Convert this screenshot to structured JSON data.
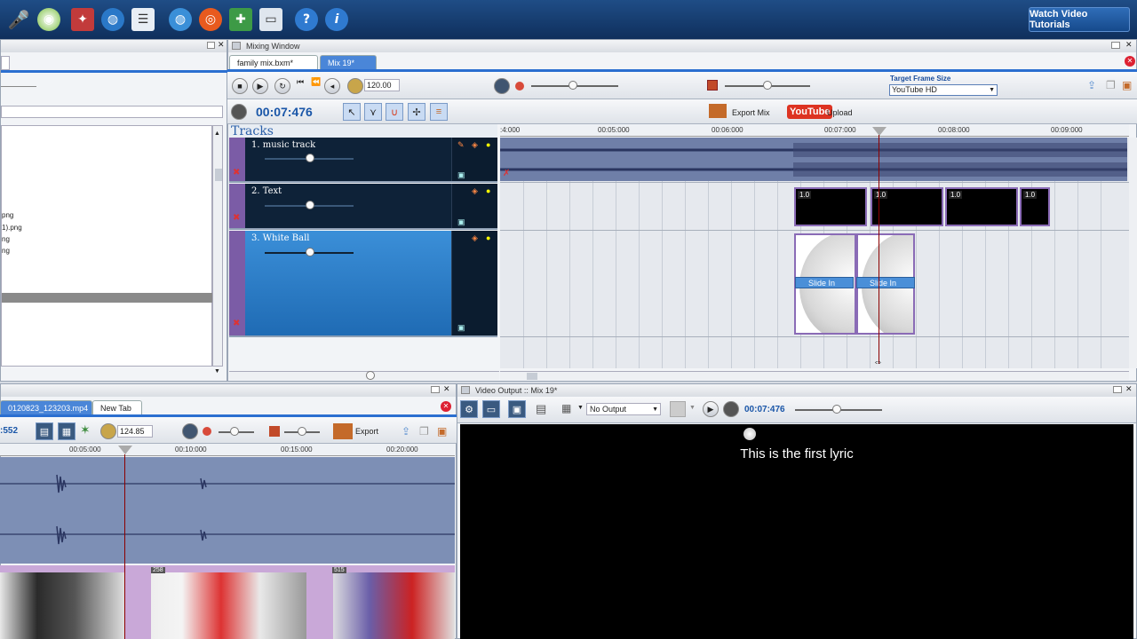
{
  "top_toolbar": {
    "watch_label": "Watch Video Tutorials"
  },
  "mixing_window": {
    "title": "Mixing Window",
    "tabs": [
      {
        "label": "family mix.bxm*"
      },
      {
        "label": "Mix 19*"
      }
    ],
    "bpm_value": "120.00",
    "time_display": "00:07:476",
    "export_label": "Export Mix",
    "upload_label": "Upload",
    "youtube_label": "YouTube",
    "target_frame_label": "Target Frame Size",
    "target_frame_value": "YouTube HD",
    "tracks_heading": "Tracks",
    "tracks": [
      {
        "label": "1. music track"
      },
      {
        "label": "2. Text"
      },
      {
        "label": "3. White Ball"
      }
    ],
    "ruler_ticks": [
      ":4:000",
      "00:05:000",
      "00:06:000",
      "00:07:000",
      "00:08:000",
      "00:09:000"
    ],
    "text_clip_nums": [
      "1.0",
      "1.0",
      "1.0",
      "1.0"
    ],
    "slide_labels": [
      "Slide In",
      "Slide In"
    ]
  },
  "file_list": {
    "items": [
      "png",
      "1).png",
      "ng",
      "ng"
    ]
  },
  "editor": {
    "tabs": [
      {
        "label": "0120823_123203.mp4"
      },
      {
        "label": "New Tab"
      }
    ],
    "time_fragment": ":552",
    "value": "124.85",
    "export_label": "Export",
    "ruler_ticks": [
      "00:05:000",
      "00:10:000",
      "00:15:000",
      "00:20:000"
    ],
    "frame_labels": [
      "258",
      "515"
    ]
  },
  "video_output": {
    "title": "Video Output :: Mix 19*",
    "output_select": "No Output",
    "time_display": "00:07:476",
    "lyric": "This is the first lyric"
  },
  "colors": {
    "accent": "#2b6fd0",
    "track_bg": "#0e2238",
    "track_handle": "#7b5ca6",
    "playhead": "#8b0000"
  }
}
